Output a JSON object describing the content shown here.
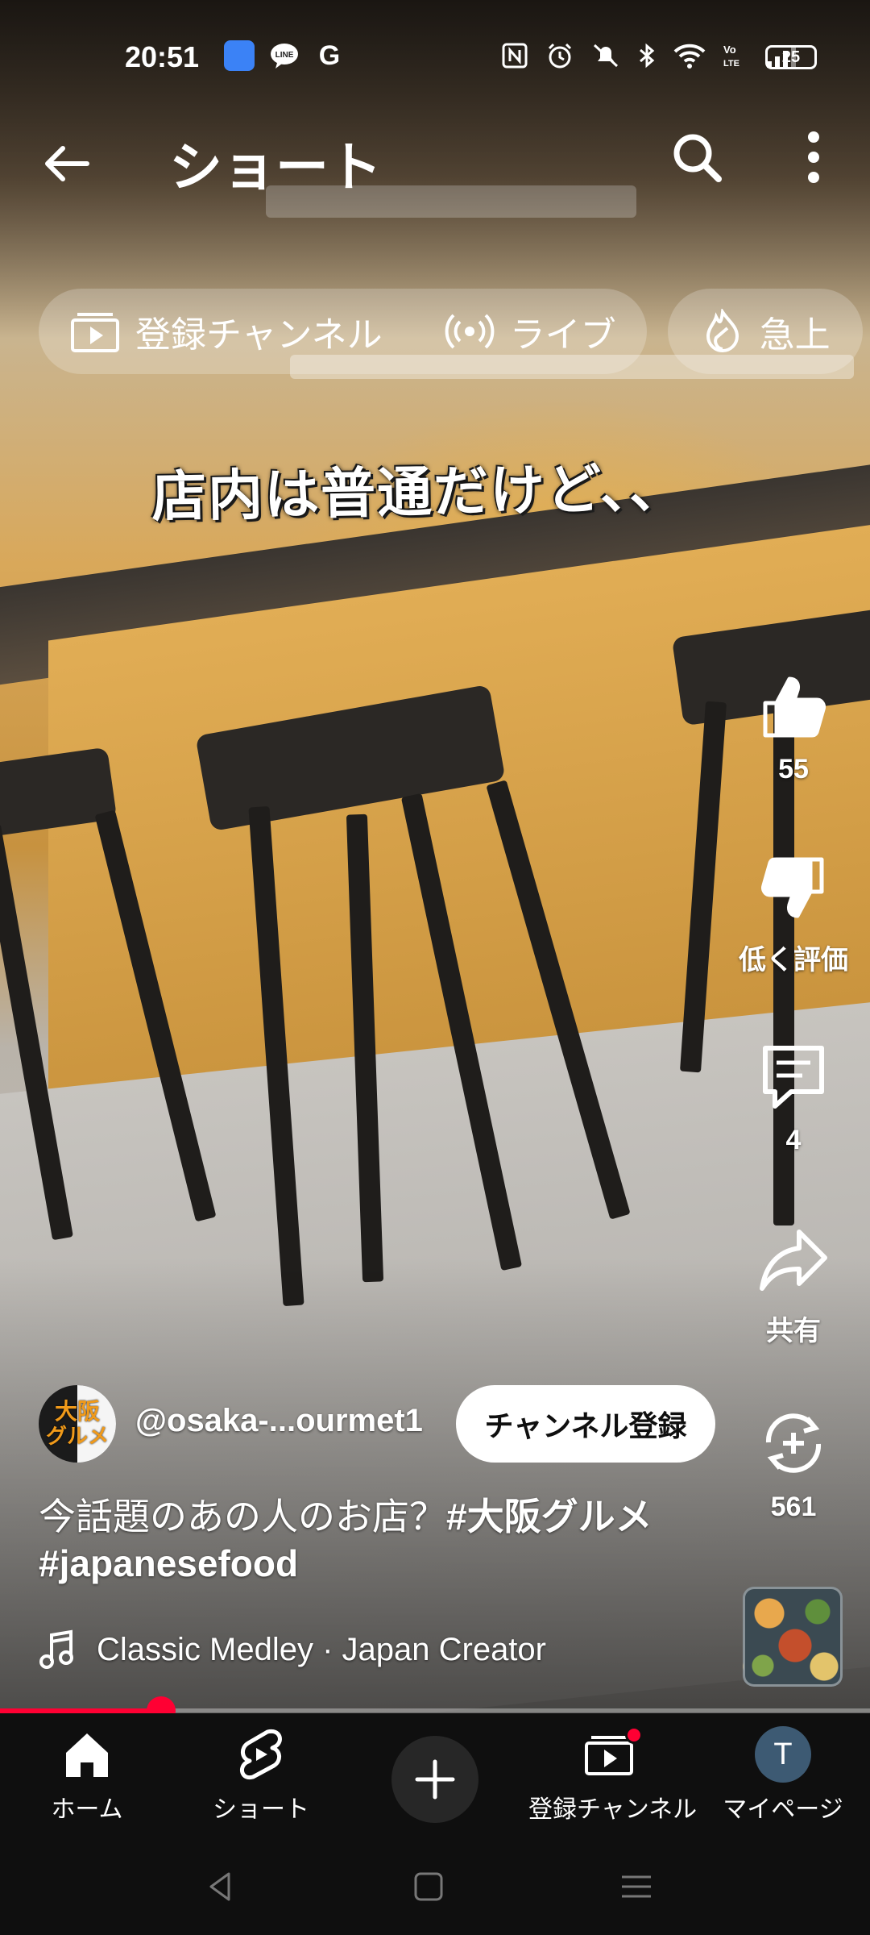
{
  "status_bar": {
    "time": "20:51",
    "notif_icons": [
      "app-icon",
      "line-icon",
      "google-icon"
    ],
    "line_label": "LINE",
    "google_label": "G",
    "battery": "25"
  },
  "header": {
    "title": "ショート"
  },
  "chips": {
    "subscriptions": "登録チャンネル",
    "live": "ライブ",
    "trending": "急上"
  },
  "video": {
    "caption": "店内は普通だけど、、"
  },
  "actions": {
    "like_count": "55",
    "dislike_label": "低く評価",
    "comment_count": "4",
    "share_label": "共有",
    "remix_count": "561"
  },
  "channel": {
    "avatar_text_line1": "大阪",
    "avatar_text_line2": "グルメ",
    "handle": "@osaka-...ourmet1",
    "subscribe_label": "チャンネル登録"
  },
  "description": {
    "text": "今話題のあの人のお店？",
    "hashtag1": "#大阪グルメ",
    "hashtag2": "#japanesefood"
  },
  "music": {
    "label": "Classic Medley · Japan Creator"
  },
  "progress": {
    "fraction": 0.185
  },
  "bottom_nav": {
    "home": "ホーム",
    "shorts": "ショート",
    "subscriptions": "登録チャンネル",
    "mypage": "マイページ",
    "avatar_initial": "T"
  },
  "colors": {
    "accent": "#ff0033",
    "background": "#0f0f0f"
  }
}
